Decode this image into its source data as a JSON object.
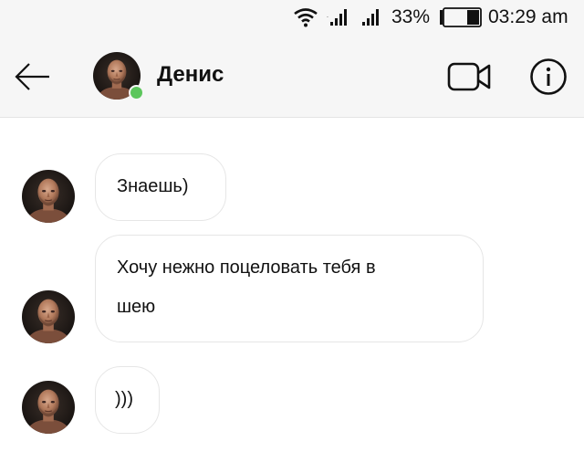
{
  "status_bar": {
    "battery_percent": "33%",
    "time": "03:29 am"
  },
  "header": {
    "contact_name": "Денис",
    "online": true,
    "icons": {
      "back": "arrow-left-icon",
      "video": "video-camera-icon",
      "info": "info-icon"
    }
  },
  "messages": [
    {
      "lines": [
        "Знаешь)"
      ]
    },
    {
      "lines": [
        "Хочу нежно поцеловать тебя в",
        "шею"
      ]
    },
    {
      "lines": [
        ")))"
      ]
    }
  ],
  "colors": {
    "online_dot": "#5cc65c",
    "header_bg": "#f6f6f6",
    "bubble_border": "#e6e6e6"
  }
}
